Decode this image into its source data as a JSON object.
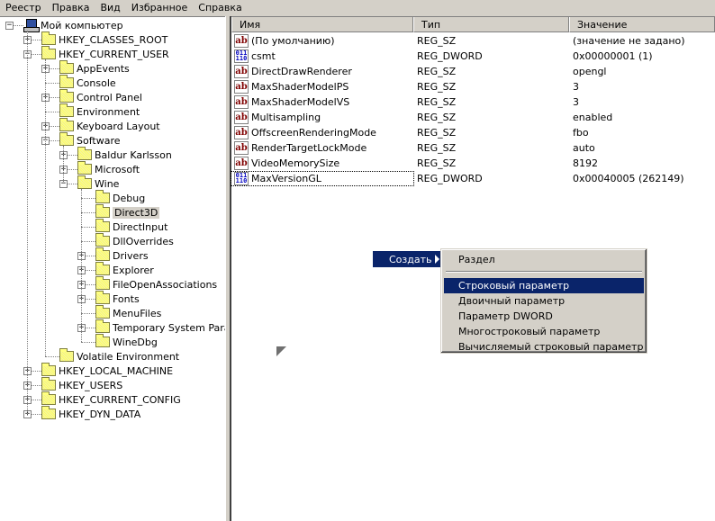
{
  "menu": [
    {
      "label": "Реестр",
      "u": "Р"
    },
    {
      "label": "Правка",
      "u": "П"
    },
    {
      "label": "Вид",
      "u": "В"
    },
    {
      "label": "Избранное",
      "u": "И"
    },
    {
      "label": "Справка",
      "u": "С"
    }
  ],
  "tree": [
    {
      "label": "Мой компьютер",
      "level": 0,
      "exp": "-",
      "icon": "pc"
    },
    {
      "label": "HKEY_CLASSES_ROOT",
      "level": 1,
      "exp": "+"
    },
    {
      "label": "HKEY_CURRENT_USER",
      "level": 1,
      "exp": "-"
    },
    {
      "label": "AppEvents",
      "level": 2,
      "exp": "+"
    },
    {
      "label": "Console",
      "level": 2,
      "exp": ""
    },
    {
      "label": "Control Panel",
      "level": 2,
      "exp": "+"
    },
    {
      "label": "Environment",
      "level": 2,
      "exp": ""
    },
    {
      "label": "Keyboard Layout",
      "level": 2,
      "exp": "+"
    },
    {
      "label": "Software",
      "level": 2,
      "exp": "-"
    },
    {
      "label": "Baldur Karlsson",
      "level": 3,
      "exp": "+"
    },
    {
      "label": "Microsoft",
      "level": 3,
      "exp": "+"
    },
    {
      "label": "Wine",
      "level": 3,
      "exp": "-"
    },
    {
      "label": "Debug",
      "level": 4,
      "exp": ""
    },
    {
      "label": "Direct3D",
      "level": 4,
      "exp": "",
      "selected": true
    },
    {
      "label": "DirectInput",
      "level": 4,
      "exp": ""
    },
    {
      "label": "DllOverrides",
      "level": 4,
      "exp": ""
    },
    {
      "label": "Drivers",
      "level": 4,
      "exp": "+"
    },
    {
      "label": "Explorer",
      "level": 4,
      "exp": "+"
    },
    {
      "label": "FileOpenAssociations",
      "level": 4,
      "exp": "+"
    },
    {
      "label": "Fonts",
      "level": 4,
      "exp": "+"
    },
    {
      "label": "MenuFiles",
      "level": 4,
      "exp": ""
    },
    {
      "label": "Temporary System Parameters",
      "level": 4,
      "exp": "+"
    },
    {
      "label": "WineDbg",
      "level": 4,
      "exp": ""
    },
    {
      "label": "Volatile Environment",
      "level": 2,
      "exp": ""
    },
    {
      "label": "HKEY_LOCAL_MACHINE",
      "level": 1,
      "exp": "+"
    },
    {
      "label": "HKEY_USERS",
      "level": 1,
      "exp": "+"
    },
    {
      "label": "HKEY_CURRENT_CONFIG",
      "level": 1,
      "exp": "+"
    },
    {
      "label": "HKEY_DYN_DATA",
      "level": 1,
      "exp": "+"
    }
  ],
  "list": {
    "headers": [
      "Имя",
      "Тип",
      "Значение"
    ],
    "rows": [
      {
        "name": "(По умолчанию)",
        "type": "REG_SZ",
        "value": "(значение не задано)"
      },
      {
        "name": "csmt",
        "type": "REG_DWORD",
        "value": "0x00000001 (1)"
      },
      {
        "name": "DirectDrawRenderer",
        "type": "REG_SZ",
        "value": "opengl"
      },
      {
        "name": "MaxShaderModelPS",
        "type": "REG_SZ",
        "value": "3"
      },
      {
        "name": "MaxShaderModelVS",
        "type": "REG_SZ",
        "value": "3"
      },
      {
        "name": "Multisampling",
        "type": "REG_SZ",
        "value": "enabled"
      },
      {
        "name": "OffscreenRenderingMode",
        "type": "REG_SZ",
        "value": "fbo"
      },
      {
        "name": "RenderTargetLockMode",
        "type": "REG_SZ",
        "value": "auto"
      },
      {
        "name": "VideoMemorySize",
        "type": "REG_SZ",
        "value": "8192"
      },
      {
        "name": "MaxVersionGL",
        "type": "REG_DWORD",
        "value": "0x00040005 (262149)",
        "focused": true
      }
    ]
  },
  "context_menu": {
    "parent": "Создать",
    "items": [
      {
        "label": "Раздел"
      },
      {
        "separator": true
      },
      {
        "label": "Строковый параметр",
        "highlighted": true
      },
      {
        "label": "Двоичный параметр"
      },
      {
        "label": "Параметр DWORD"
      },
      {
        "label": "Многостроковый параметр"
      },
      {
        "label": "Вычисляемый строковый параметр"
      }
    ]
  }
}
